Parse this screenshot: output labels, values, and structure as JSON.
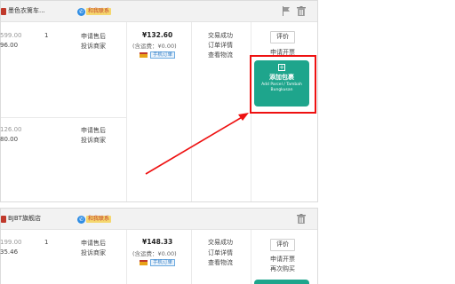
{
  "order1": {
    "shop_name": "墨色衣篱车...",
    "chat_label": "和我联系",
    "items": [
      {
        "orig_price": "599.00",
        "price": "96.00",
        "qty": "1",
        "after_sale": "申请售后",
        "complain": "投诉商家"
      },
      {
        "orig_price": "126.00",
        "price": "80.00",
        "after_sale": "申请售后",
        "complain": "投诉商家"
      }
    ],
    "total": "¥132.60",
    "shipping": "(含运费：¥0.00)",
    "mobile_tag": "手机订单",
    "status": "交易成功",
    "order_detail": "订单详情",
    "logistics": "查看物流",
    "review_label": "评价",
    "invoice_label": "申请开票",
    "add_parcel_title": "添加包裹",
    "add_parcel_sub": "Add Parcel / Tambah Bungkusan"
  },
  "order2": {
    "shop_name": "BJBT旗舰店",
    "chat_label": "和我联系",
    "items": [
      {
        "orig_price": "199.00",
        "price": "35.46",
        "qty": "1",
        "after_sale": "申请售后",
        "complain": "投诉商家"
      }
    ],
    "total": "¥148.33",
    "shipping": "(含运费：¥0.00)",
    "mobile_tag": "手机订单",
    "status": "交易成功",
    "order_detail": "订单详情",
    "logistics": "查看物流",
    "review_label": "评价",
    "invoice_label": "申请开票",
    "rebuy_label": "再次购买"
  },
  "icons": {
    "flag": "flag-icon",
    "trash": "trash-icon",
    "chat": "chat-bubble-icon",
    "wallet": "wallet-icon",
    "shop": "shop-icon",
    "plus": "plus-icon"
  },
  "colors": {
    "accent_green": "#1ea58c",
    "highlight_red": "#ee1111",
    "chat_blue": "#2f8de4"
  }
}
